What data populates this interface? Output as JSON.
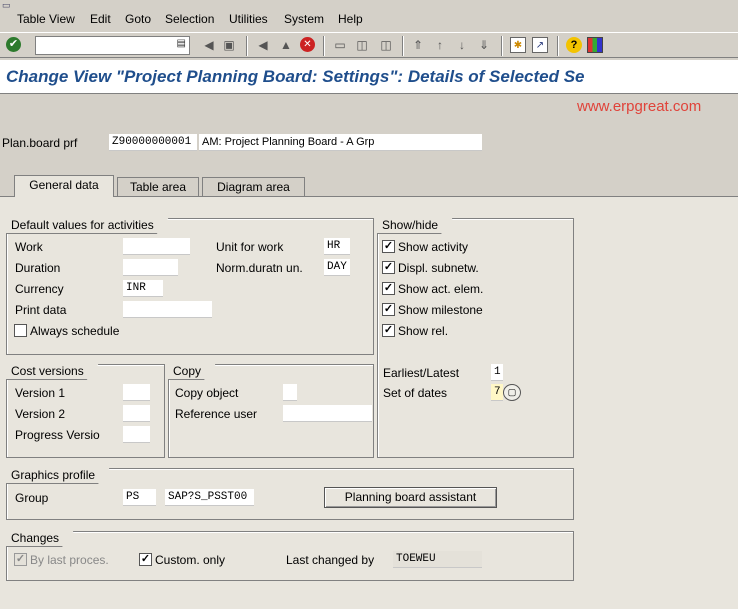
{
  "menu": [
    "Table View",
    "Edit",
    "Goto",
    "Selection",
    "Utilities",
    "System",
    "Help"
  ],
  "title": "Change View \"Project Planning Board: Settings\": Details of Selected Se",
  "watermark": "www.erpgreat.com",
  "header": {
    "label": "Plan.board prf",
    "value": "Z90000000001",
    "description": "AM: Project Planning Board - A Grp"
  },
  "tabs": [
    "General data",
    "Table area",
    "Diagram area"
  ],
  "default_values": {
    "title": "Default values for activities",
    "work_label": "Work",
    "work_value": "",
    "duration_label": "Duration",
    "duration_value": "",
    "currency_label": "Currency",
    "currency_value": "INR",
    "print_data_label": "Print data",
    "print_data_value": "",
    "always_schedule_label": "Always schedule",
    "unit_for_work_label": "Unit for work",
    "unit_for_work_value": "HR",
    "norm_duration_label": "Norm.duratn un.",
    "norm_duration_value": "DAY"
  },
  "show_hide": {
    "title": "Show/hide",
    "items": [
      "Show activity",
      "Displ. subnetw.",
      "Show act. elem.",
      "Show milestone",
      "Show rel."
    ],
    "earliest_latest_label": "Earliest/Latest",
    "earliest_latest_value": "1",
    "set_of_dates_label": "Set of dates",
    "set_of_dates_value": "7"
  },
  "cost_versions": {
    "title": "Cost versions",
    "version1_label": "Version 1",
    "version2_label": "Version 2",
    "progress_label": "Progress Versio"
  },
  "copy": {
    "title": "Copy",
    "copy_object_label": "Copy object",
    "reference_user_label": "Reference user"
  },
  "graphics_profile": {
    "title": "Graphics profile",
    "group_label": "Group",
    "group_value": "PS",
    "profile_value": "SAP?S_PSST00",
    "assistant_button": "Planning board assistant"
  },
  "changes": {
    "title": "Changes",
    "by_last_label": "By last proces.",
    "custom_only_label": "Custom. only",
    "last_changed_label": "Last changed by",
    "last_changed_value": "TOEWEU"
  }
}
